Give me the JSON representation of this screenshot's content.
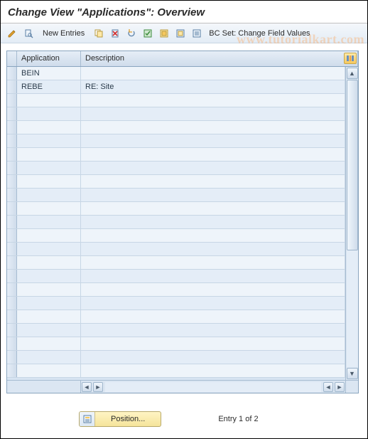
{
  "title": "Change View \"Applications\": Overview",
  "toolbar": {
    "new_entries": "New Entries",
    "bc_set_label": "BC Set: Change Field Values"
  },
  "watermark": "www.tutorialkart.com",
  "grid": {
    "columns": {
      "application": "Application",
      "description": "Description"
    },
    "rows": [
      {
        "application": "BEIN",
        "description": ""
      },
      {
        "application": "REBE",
        "description": "RE: Site"
      }
    ],
    "empty_count": 21
  },
  "footer": {
    "position_label": "Position...",
    "entry_text": "Entry 1 of 2"
  }
}
